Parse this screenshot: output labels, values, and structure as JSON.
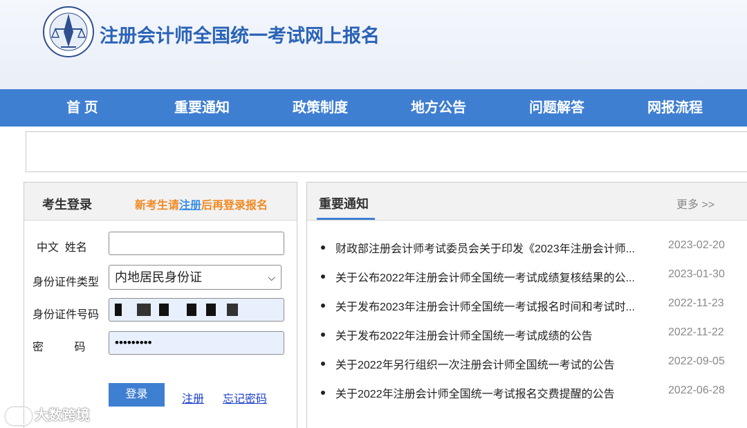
{
  "header": {
    "title": "注册会计师全国统一考试网上报名"
  },
  "nav": {
    "items": [
      "首 页",
      "重要通知",
      "政策制度",
      "地方公告",
      "问题解答",
      "网报流程"
    ]
  },
  "login": {
    "title": "考生登录",
    "hint_prefix": "新考生请",
    "hint_link": "注册",
    "hint_suffix": "后再登录报名",
    "name_label": "中文  姓名",
    "name_value": "",
    "id_type_label": "身份证件类型",
    "id_type_value": "内地居民身份证",
    "id_number_label": "身份证件号码",
    "password_label": "密          码",
    "password_value": "•••••••••",
    "login_button": "登录",
    "register_link": "注册",
    "forgot_link": "忘记密码"
  },
  "notices": {
    "title": "重要通知",
    "more": "更多 >>",
    "items": [
      {
        "text": "财政部注册会计师考试委员会关于印发《2023年注册会计师...",
        "date": "2023-02-20"
      },
      {
        "text": "关于公布2022年注册会计师全国统一考试成绩复核结果的公...",
        "date": "2023-01-30"
      },
      {
        "text": "关于发布2023年注册会计师全国统一考试报名时间和考试时...",
        "date": "2022-11-23"
      },
      {
        "text": "关于发布2022年注册会计师全国统一考试成绩的公告",
        "date": "2022-11-22"
      },
      {
        "text": "关于2022年另行组织一次注册会计师全国统一考试的公告",
        "date": "2022-09-05"
      },
      {
        "text": "关于2022年注册会计师全国统一考试报名交费提醒的公告",
        "date": "2022-06-28"
      }
    ]
  },
  "watermark": {
    "text": "大数跨境",
    "icon": "watermark-logo-icon"
  },
  "colors": {
    "brand_blue": "#3f7fd1",
    "title_blue": "#2a63b8",
    "hint_orange": "#f08a24",
    "link_blue": "#1a3fcc"
  }
}
